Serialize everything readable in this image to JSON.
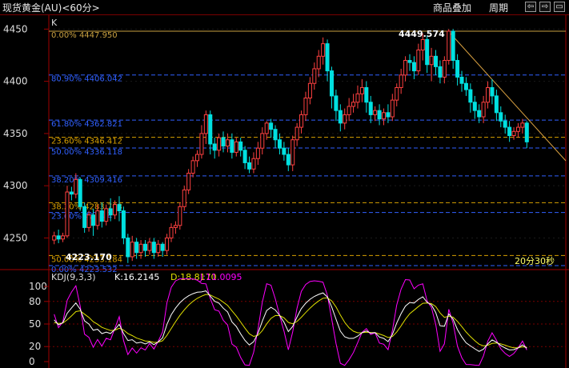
{
  "window": {
    "title": "现货黄金(AU)<60分>",
    "overlay_button": "商品叠加",
    "period_button": "周期",
    "prev_icon": "arrow-left-icon",
    "next_icon": "arrow-right-icon",
    "restore_icon": "window-restore-icon",
    "prev_glyph": "⇦",
    "next_glyph": "⇨",
    "restore_glyph": "▭"
  },
  "main": {
    "corner_label": "K",
    "countdown": "20分30秒",
    "high_label": "4449.574",
    "low_label": "4223.170",
    "fib_levels": [
      {
        "label": "0.00% 4447.950",
        "value": 4447.95,
        "color": "#c8a040",
        "style": "solid"
      },
      {
        "label": "80.90% 4406.042",
        "value": 4406.042,
        "color": "#3060ff",
        "style": "dash"
      },
      {
        "label": "61.80% 4362.821",
        "value": 4362.821,
        "color": "#3060ff",
        "style": "dash"
      },
      {
        "label": "23.60% 4346.412",
        "value": 4346.412,
        "color": "#d8a000",
        "style": "dash"
      },
      {
        "label": "50.00% 4336.118",
        "value": 4336.118,
        "color": "#3060ff",
        "style": "dash"
      },
      {
        "label": "38.20% 4309.416",
        "value": 4309.416,
        "color": "#3060ff",
        "style": "dash"
      },
      {
        "label": "38.20% 4283.793",
        "value": 4283.793,
        "color": "#d8a000",
        "style": "dash"
      },
      {
        "label": "23.60% 4274.4",
        "value": 4274.4,
        "color": "#3060ff",
        "style": "dash"
      },
      {
        "label": "50.00% 4233.184",
        "value": 4233.184,
        "color": "#d8a000",
        "style": "dash"
      },
      {
        "label": "0.00% 4223.532",
        "value": 4223.532,
        "color": "#3060ff",
        "style": "dash"
      }
    ],
    "y_ticks": [
      "4450",
      "4400",
      "4350",
      "4300",
      "4250"
    ]
  },
  "indicator": {
    "name": "KDJ(9,3,3)",
    "k_label": "K:16.2145",
    "d_label": "D:18.8170",
    "j_label": "J:11.0095",
    "k_color": "#ffffff",
    "d_color": "#e0e000",
    "j_color": "#ff00ff",
    "y_ticks": [
      "100",
      "80",
      "50",
      "20",
      "0"
    ]
  },
  "chart_data": {
    "type": "candlestick",
    "y_range": [
      4222,
      4461
    ],
    "up_color": "#ff4040",
    "down_color": "#00e0e0",
    "candles": [
      [
        4248,
        4252,
        4244,
        4256
      ],
      [
        4252,
        4249,
        4245,
        4258
      ],
      [
        4249,
        4252,
        4246,
        4255
      ],
      [
        4252,
        4294,
        4250,
        4300
      ],
      [
        4294,
        4292,
        4286,
        4299
      ],
      [
        4292,
        4306,
        4288,
        4312
      ],
      [
        4306,
        4280,
        4276,
        4308
      ],
      [
        4280,
        4260,
        4255,
        4284
      ],
      [
        4260,
        4272,
        4256,
        4276
      ],
      [
        4272,
        4262,
        4252,
        4278
      ],
      [
        4262,
        4276,
        4258,
        4282
      ],
      [
        4276,
        4266,
        4260,
        4284
      ],
      [
        4266,
        4278,
        4262,
        4282
      ],
      [
        4278,
        4272,
        4266,
        4288
      ],
      [
        4272,
        4282,
        4268,
        4286
      ],
      [
        4282,
        4276,
        4266,
        4290
      ],
      [
        4276,
        4250,
        4244,
        4280
      ],
      [
        4250,
        4232,
        4226,
        4254
      ],
      [
        4232,
        4246,
        4228,
        4252
      ],
      [
        4246,
        4236,
        4230,
        4250
      ],
      [
        4236,
        4244,
        4230,
        4248
      ],
      [
        4244,
        4238,
        4232,
        4248
      ],
      [
        4238,
        4246,
        4234,
        4250
      ],
      [
        4246,
        4236,
        4230,
        4250
      ],
      [
        4236,
        4244,
        4232,
        4248
      ],
      [
        4244,
        4238,
        4232,
        4246
      ],
      [
        4238,
        4250,
        4234,
        4254
      ],
      [
        4250,
        4260,
        4246,
        4264
      ],
      [
        4260,
        4262,
        4254,
        4266
      ],
      [
        4262,
        4280,
        4258,
        4284
      ],
      [
        4280,
        4296,
        4276,
        4300
      ],
      [
        4296,
        4312,
        4292,
        4316
      ],
      [
        4312,
        4324,
        4308,
        4328
      ],
      [
        4324,
        4330,
        4318,
        4334
      ],
      [
        4330,
        4350,
        4326,
        4358
      ],
      [
        4350,
        4368,
        4340,
        4372
      ],
      [
        4368,
        4340,
        4330,
        4372
      ],
      [
        4340,
        4334,
        4326,
        4346
      ],
      [
        4334,
        4346,
        4328,
        4350
      ],
      [
        4346,
        4338,
        4332,
        4352
      ],
      [
        4338,
        4344,
        4332,
        4350
      ],
      [
        4344,
        4332,
        4326,
        4350
      ],
      [
        4332,
        4342,
        4328,
        4346
      ],
      [
        4342,
        4334,
        4328,
        4346
      ],
      [
        4334,
        4322,
        4316,
        4338
      ],
      [
        4322,
        4316,
        4312,
        4328
      ],
      [
        4316,
        4326,
        4312,
        4332
      ],
      [
        4326,
        4336,
        4320,
        4342
      ],
      [
        4336,
        4350,
        4330,
        4356
      ],
      [
        4350,
        4360,
        4344,
        4362
      ],
      [
        4360,
        4354,
        4346,
        4364
      ],
      [
        4354,
        4344,
        4336,
        4358
      ],
      [
        4344,
        4336,
        4330,
        4350
      ],
      [
        4336,
        4330,
        4324,
        4342
      ],
      [
        4330,
        4320,
        4314,
        4336
      ],
      [
        4320,
        4344,
        4314,
        4348
      ],
      [
        4344,
        4356,
        4338,
        4360
      ],
      [
        4356,
        4368,
        4350,
        4372
      ],
      [
        4368,
        4384,
        4362,
        4390
      ],
      [
        4384,
        4398,
        4378,
        4404
      ],
      [
        4398,
        4412,
        4392,
        4418
      ],
      [
        4412,
        4424,
        4404,
        4430
      ],
      [
        4424,
        4436,
        4416,
        4442
      ],
      [
        4436,
        4410,
        4400,
        4440
      ],
      [
        4410,
        4386,
        4374,
        4414
      ],
      [
        4386,
        4372,
        4362,
        4392
      ],
      [
        4372,
        4360,
        4352,
        4378
      ],
      [
        4360,
        4368,
        4354,
        4374
      ],
      [
        4368,
        4376,
        4362,
        4384
      ],
      [
        4376,
        4380,
        4370,
        4388
      ],
      [
        4380,
        4388,
        4374,
        4396
      ],
      [
        4388,
        4394,
        4380,
        4402
      ],
      [
        4394,
        4380,
        4370,
        4400
      ],
      [
        4380,
        4368,
        4360,
        4386
      ],
      [
        4368,
        4372,
        4362,
        4376
      ],
      [
        4372,
        4364,
        4358,
        4378
      ],
      [
        4364,
        4370,
        4358,
        4374
      ],
      [
        4370,
        4366,
        4360,
        4378
      ],
      [
        4366,
        4382,
        4362,
        4388
      ],
      [
        4382,
        4394,
        4376,
        4398
      ],
      [
        4394,
        4406,
        4388,
        4412
      ],
      [
        4406,
        4420,
        4400,
        4424
      ],
      [
        4420,
        4418,
        4410,
        4426
      ],
      [
        4418,
        4410,
        4402,
        4424
      ],
      [
        4410,
        4430,
        4406,
        4436
      ],
      [
        4430,
        4440,
        4420,
        4446
      ],
      [
        4440,
        4416,
        4408,
        4444
      ],
      [
        4416,
        4424,
        4400,
        4432
      ],
      [
        4424,
        4414,
        4406,
        4430
      ],
      [
        4414,
        4404,
        4398,
        4420
      ],
      [
        4404,
        4420,
        4398,
        4424
      ],
      [
        4420,
        4448,
        4416,
        4450
      ],
      [
        4448,
        4420,
        4412,
        4450
      ],
      [
        4420,
        4404,
        4396,
        4426
      ],
      [
        4404,
        4398,
        4390,
        4410
      ],
      [
        4398,
        4392,
        4386,
        4404
      ],
      [
        4392,
        4380,
        4370,
        4398
      ],
      [
        4380,
        4372,
        4364,
        4386
      ],
      [
        4372,
        4366,
        4360,
        4378
      ],
      [
        4366,
        4380,
        4360,
        4386
      ],
      [
        4380,
        4394,
        4374,
        4400
      ],
      [
        4394,
        4386,
        4378,
        4402
      ],
      [
        4386,
        4370,
        4362,
        4392
      ],
      [
        4370,
        4362,
        4356,
        4376
      ],
      [
        4362,
        4356,
        4350,
        4368
      ],
      [
        4356,
        4348,
        4342,
        4362
      ],
      [
        4348,
        4352,
        4344,
        4356
      ],
      [
        4352,
        4356,
        4346,
        4360
      ],
      [
        4356,
        4360,
        4350,
        4364
      ],
      [
        4360,
        4342,
        4336,
        4362
      ]
    ]
  }
}
